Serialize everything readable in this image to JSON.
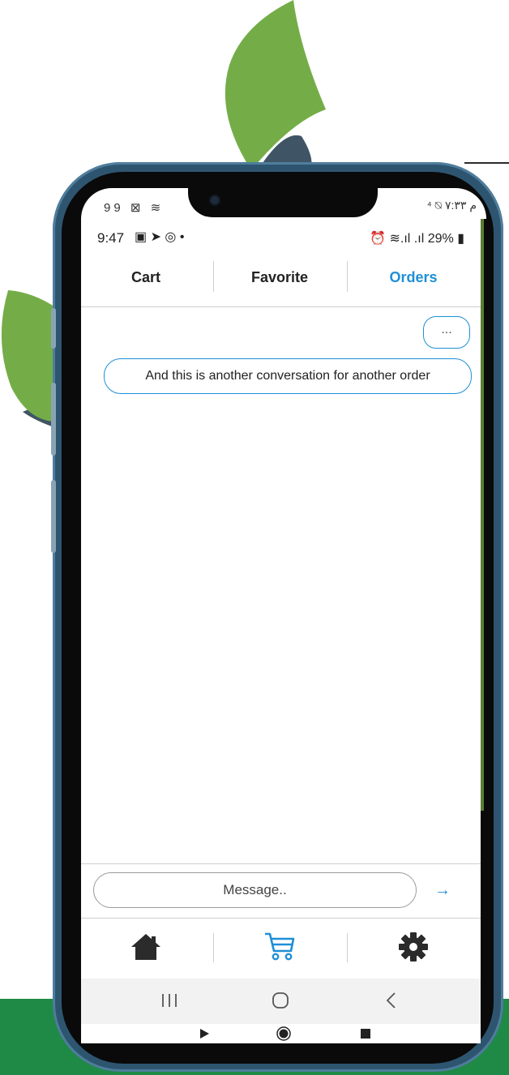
{
  "outer_status": {
    "left_icons": "99 ⊠ ≋",
    "right_text": "⁴ ⍉ م ٧:٣٣"
  },
  "status_bar": {
    "time": "9:47",
    "left_icons": "▣ ➤ ◎ •",
    "right_icons": "⏰ ≋.ıl .ıl",
    "battery": "29%"
  },
  "tabs": [
    {
      "label": "Cart",
      "active": false
    },
    {
      "label": "Favorite",
      "active": false
    },
    {
      "label": "Orders",
      "active": true
    }
  ],
  "chat": {
    "more_label": "...",
    "messages": [
      {
        "text": "And this is another conversation for another order"
      }
    ]
  },
  "composer": {
    "placeholder": "Message..",
    "send_icon": "arrow-right-icon"
  },
  "bottom_nav": [
    {
      "icon": "home-icon",
      "active": false
    },
    {
      "icon": "cart-icon",
      "active": true
    },
    {
      "icon": "gear-icon",
      "active": false
    }
  ],
  "system_nav": [
    "recents-icon",
    "home-circle-icon",
    "back-icon"
  ],
  "colors": {
    "accent": "#1f8fd6",
    "leaf_green": "#74ad47",
    "leaf_shadow": "#3f5566",
    "band_green": "#1f8a46",
    "frame_blue": "#2e5570"
  }
}
